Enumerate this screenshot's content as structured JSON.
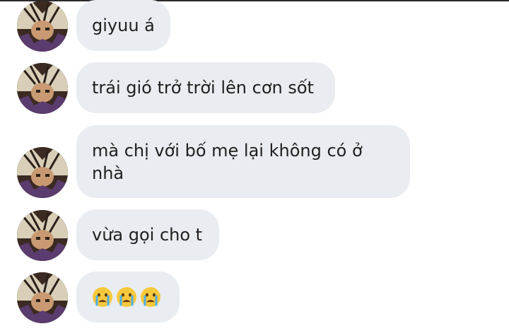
{
  "conversation": {
    "messages": [
      {
        "text": "giyuu á"
      },
      {
        "text": "trái gió trở trời lên cơn sốt"
      },
      {
        "text": "mà chị với bố mẹ lại không có ở nhà"
      },
      {
        "text": "vừa gọi cho t"
      },
      {
        "emojis": [
          "crying-face-emoji",
          "crying-face-emoji",
          "crying-face-emoji"
        ]
      }
    ]
  },
  "colors": {
    "bubble_bg": "#e9ecf0",
    "text": "#1f1f1f",
    "top_border": "#2b2b2b"
  }
}
